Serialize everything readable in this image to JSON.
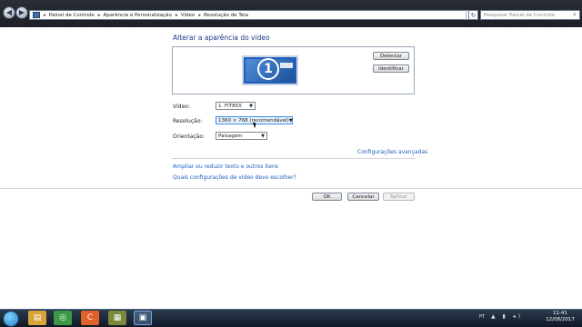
{
  "window": {
    "back_glyph": "◀",
    "forward_glyph": "▶",
    "breadcrumb": [
      "Painel de Controle",
      "Aparência e Personalização",
      "Vídeo",
      "Resolução de Tela"
    ],
    "separator": "▸",
    "address_dropdown_glyph": "▾",
    "refresh_glyph": "↻",
    "search_placeholder": "Pesquisar Painel de Controle",
    "search_glyph": "⌕"
  },
  "main": {
    "title": "Alterar a aparência do vídeo",
    "monitor_number": "1",
    "detect_label": "Detectar",
    "identify_label": "Identificar",
    "video_label": "Vídeo:",
    "video_value": "1. FIT85X",
    "resolution_label": "Resolução:",
    "resolution_value": "1360 × 768 (recomendável)",
    "orientation_label": "Orientação:",
    "orientation_value": "Paisagem",
    "select_arrow": "▼",
    "advanced_link": "Configurações avançadas",
    "text_size_link": "Ampliar ou reduzir texto e outros itens",
    "which_settings_link": "Quais configurações de vídeo devo escolher?",
    "ok_label": "OK",
    "cancel_label": "Cancelar",
    "apply_label": "Aplicar"
  },
  "taskbar": {
    "apps": [
      {
        "name": "explorer",
        "glyph": "▤",
        "color": "#d9a43a"
      },
      {
        "name": "chrome",
        "glyph": "◎",
        "color": "#3a9a46"
      },
      {
        "name": "app-orange",
        "glyph": "C",
        "color": "#e0622a"
      },
      {
        "name": "minecraft",
        "glyph": "▦",
        "color": "#7a8a3a"
      },
      {
        "name": "display-settings",
        "glyph": "▣",
        "color": "#4a7ab8"
      }
    ],
    "language": "PT",
    "tray_icons": "▲ ▮ ◂)",
    "time": "11:41",
    "date": "12/08/2017"
  }
}
